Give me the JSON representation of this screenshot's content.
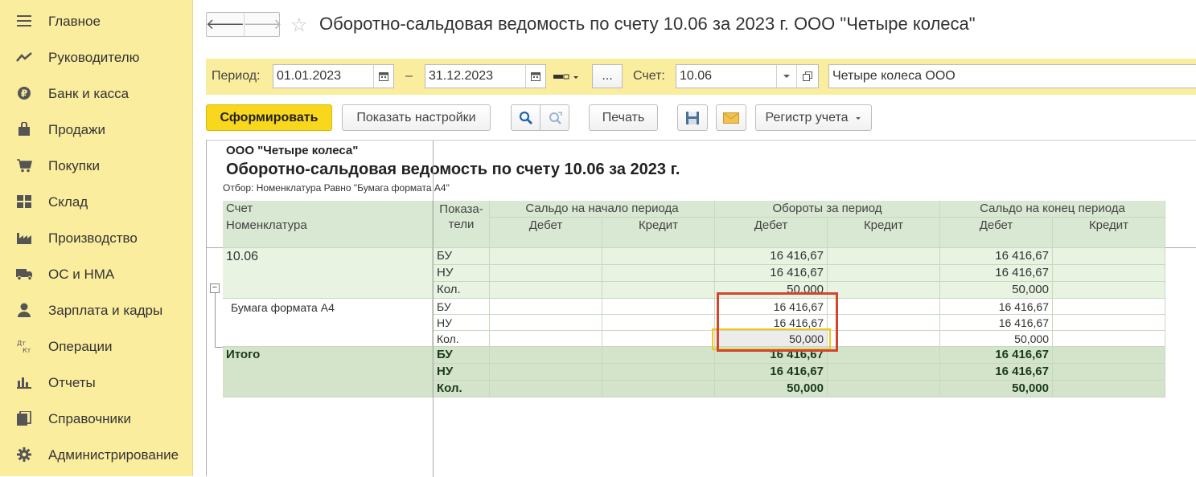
{
  "sidebar": {
    "items": [
      {
        "label": "Главное",
        "icon": "menu-icon"
      },
      {
        "label": "Руководителю",
        "icon": "trend-icon"
      },
      {
        "label": "Банк и касса",
        "icon": "ruble-icon"
      },
      {
        "label": "Продажи",
        "icon": "bag-icon"
      },
      {
        "label": "Покупки",
        "icon": "cart-icon"
      },
      {
        "label": "Склад",
        "icon": "warehouse-icon"
      },
      {
        "label": "Производство",
        "icon": "factory-icon"
      },
      {
        "label": "ОС и НМА",
        "icon": "truck-icon"
      },
      {
        "label": "Зарплата и кадры",
        "icon": "person-icon"
      },
      {
        "label": "Операции",
        "icon": "dt-kt-icon"
      },
      {
        "label": "Отчеты",
        "icon": "bar-chart-icon"
      },
      {
        "label": "Справочники",
        "icon": "books-icon"
      },
      {
        "label": "Администрирование",
        "icon": "gear-icon"
      }
    ]
  },
  "header": {
    "back": "🡐",
    "forward": "🡒",
    "star": "☆",
    "title": "Оборотно-сальдовая ведомость по счету 10.06 за 2023 г. ООО \"Четыре колеса\""
  },
  "filters": {
    "period_label": "Период:",
    "date_from": "01.01.2023",
    "dash": "–",
    "date_to": "31.12.2023",
    "ellipsis": "...",
    "account_label": "Счет:",
    "account": "10.06",
    "organization": "Четыре колеса ООО"
  },
  "toolbar": {
    "generate": "Сформировать",
    "show_settings": "Показать настройки",
    "print": "Печать",
    "register": "Регистр учета"
  },
  "report": {
    "org": "ООО \"Четыре колеса\"",
    "title": "Оборотно-сальдовая ведомость по счету 10.06 за 2023 г.",
    "filter": "Отбор: Номенклатура Равно \"Бумага формата А4\"",
    "headers": {
      "account": "Счет",
      "nomenclature": "Номенклатура",
      "indicators": "Показа-\nтели",
      "opening": "Сальдо на начало периода",
      "turnover": "Обороты за период",
      "closing": "Сальдо на конец периода",
      "debit": "Дебет",
      "credit": "Кредит"
    },
    "group": {
      "name": "10.06",
      "rows": [
        {
          "ind": "БУ",
          "turn_dt": "16 416,67",
          "close_dt": "16 416,67"
        },
        {
          "ind": "НУ",
          "turn_dt": "16 416,67",
          "close_dt": "16 416,67"
        },
        {
          "ind": "Кол.",
          "turn_dt": "50,000",
          "close_dt": "50,000"
        }
      ]
    },
    "detail": {
      "name": "Бумага формата А4",
      "rows": [
        {
          "ind": "БУ",
          "turn_dt": "16 416,67",
          "close_dt": "16 416,67"
        },
        {
          "ind": "НУ",
          "turn_dt": "16 416,67",
          "close_dt": "16 416,67"
        },
        {
          "ind": "Кол.",
          "turn_dt": "50,000",
          "close_dt": "50,000"
        }
      ]
    },
    "total": {
      "name": "Итого",
      "rows": [
        {
          "ind": "БУ",
          "turn_dt": "16 416,67",
          "close_dt": "16 416,67"
        },
        {
          "ind": "НУ",
          "turn_dt": "16 416,67",
          "close_dt": "16 416,67"
        },
        {
          "ind": "Кол.",
          "turn_dt": "50,000",
          "close_dt": "50,000"
        }
      ]
    }
  }
}
